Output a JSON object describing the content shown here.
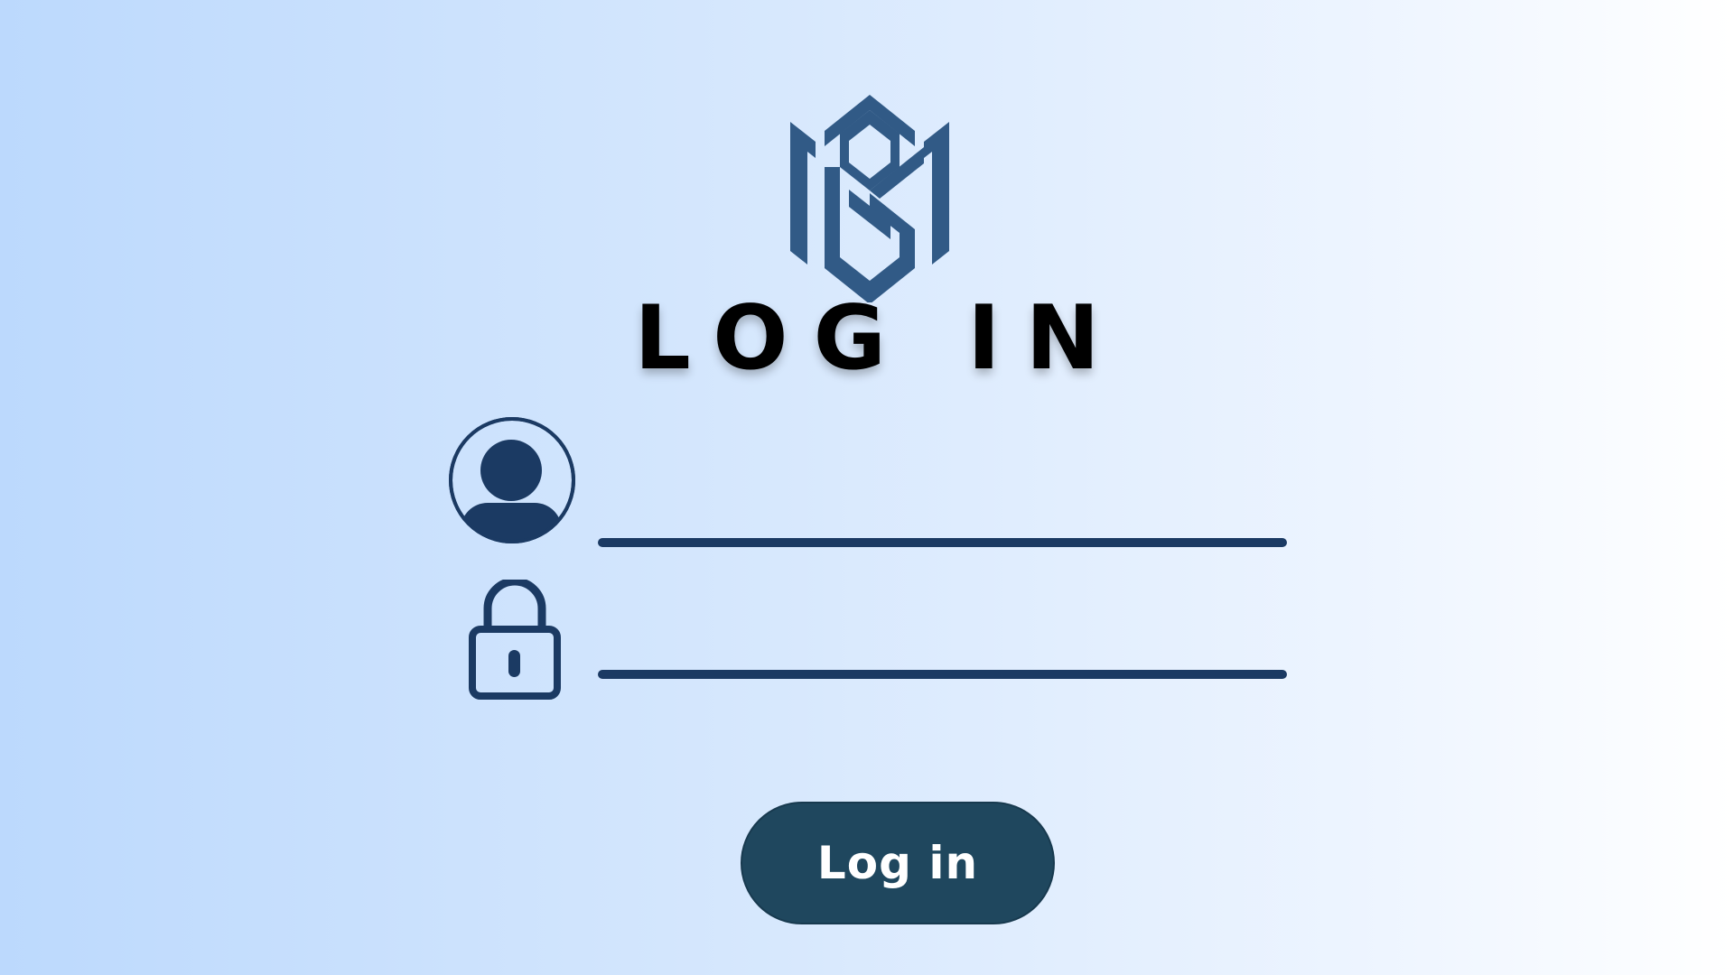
{
  "page": {
    "title": "LOG IN"
  },
  "logo": {
    "icon": "shield-logo-icon",
    "color": "#315a86"
  },
  "username": {
    "icon": "user-avatar-icon",
    "value": "",
    "placeholder": ""
  },
  "password": {
    "icon": "lock-icon",
    "value": "",
    "placeholder": ""
  },
  "actions": {
    "login_label": "Log in"
  },
  "colors": {
    "accent": "#1b3a63",
    "button": "#1f475e",
    "background_start": "#bcd9fd",
    "background_end": "#ffffff",
    "text": "#000000"
  }
}
